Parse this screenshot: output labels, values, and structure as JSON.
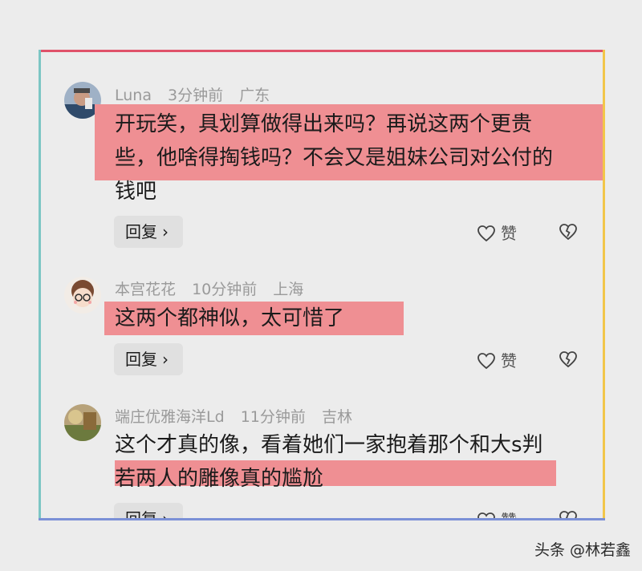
{
  "comments": [
    {
      "user": "Luna",
      "time": "3分钟前",
      "location": "广东",
      "lines": [
        "开玩笑，具划算做得出来吗？再说这两个更贵",
        "些，他啥得掏钱吗？不会又是姐妹公司对公付的",
        "钱吧"
      ],
      "reply_label": "回复",
      "like_label": "赞"
    },
    {
      "user": "本宫花花",
      "time": "10分钟前",
      "location": "上海",
      "lines": [
        "这两个都神似，太可惜了"
      ],
      "reply_label": "回复",
      "like_label": "赞"
    },
    {
      "user": "端庄优雅海洋Ld",
      "time": "11分钟前",
      "location": "吉林",
      "lines": [
        "这个才真的像，看着她们一家抱着那个和大s判",
        "若两人的雕像真的尴尬"
      ],
      "reply_label": "回复",
      "like_label": "赞"
    }
  ],
  "icons": {
    "reply_chevron": "chevron-right-icon",
    "like": "heart-icon",
    "dislike": "broken-heart-icon"
  },
  "colors": {
    "highlight": "#ef8f93",
    "frame_top": "#e0526a",
    "frame_left": "#7cc6c4",
    "frame_right": "#f2c64a",
    "frame_bottom": "#7b90d6"
  },
  "watermark": "头条 @林若鑫"
}
